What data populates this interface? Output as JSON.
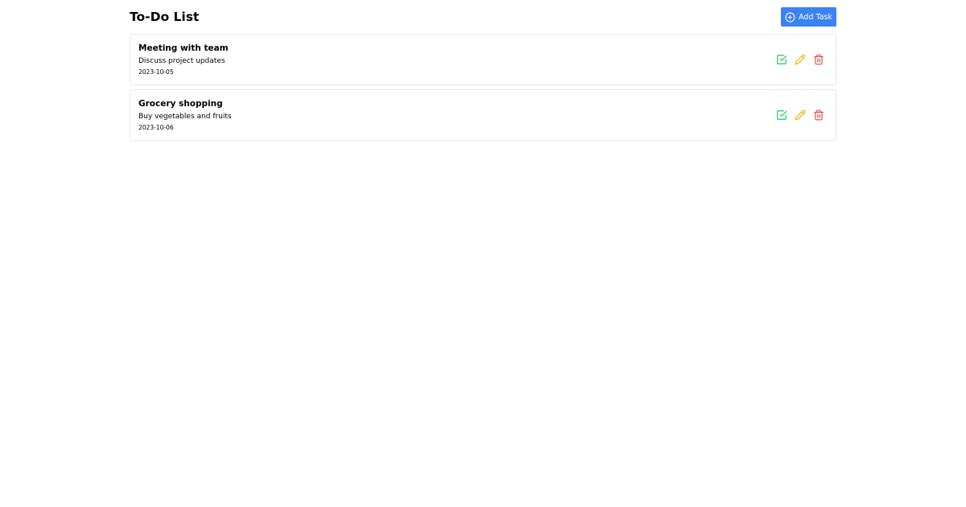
{
  "header": {
    "title": "To-Do List",
    "add_button_label": "Add Task",
    "add_icon": "plus-circle-icon"
  },
  "colors": {
    "primary": "#3b82f6",
    "complete": "#22c55e",
    "edit": "#eab308",
    "delete": "#ef4444",
    "border": "#e5e7eb"
  },
  "tasks": [
    {
      "title": "Meeting with team",
      "description": "Discuss project updates",
      "date": "2023-10-05"
    },
    {
      "title": "Grocery shopping",
      "description": "Buy vegetables and fruits",
      "date": "2023-10-06"
    }
  ],
  "icons": {
    "complete": "check-square-icon",
    "edit": "pencil-icon",
    "delete": "trash-icon"
  }
}
